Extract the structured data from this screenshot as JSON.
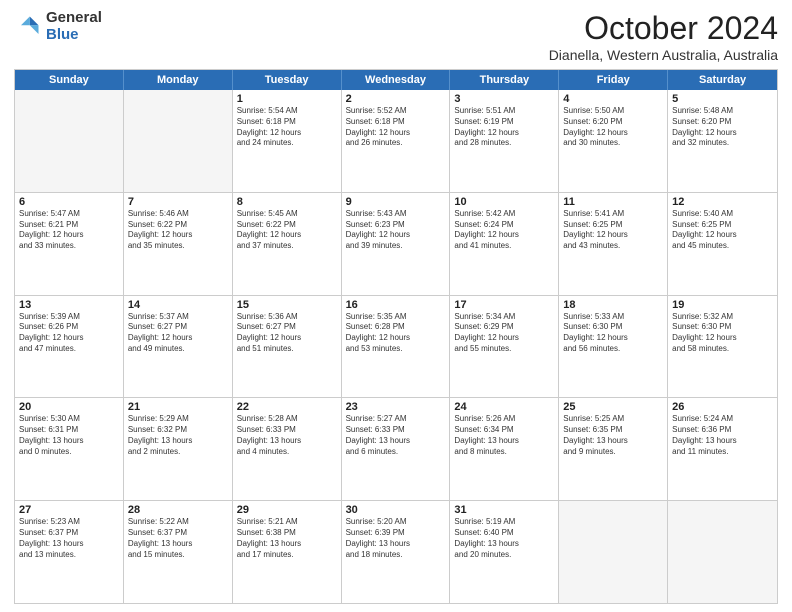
{
  "logo": {
    "general": "General",
    "blue": "Blue"
  },
  "header": {
    "month": "October 2024",
    "location": "Dianella, Western Australia, Australia"
  },
  "weekdays": [
    "Sunday",
    "Monday",
    "Tuesday",
    "Wednesday",
    "Thursday",
    "Friday",
    "Saturday"
  ],
  "rows": [
    [
      {
        "day": "",
        "info": "",
        "empty": true
      },
      {
        "day": "",
        "info": "",
        "empty": true
      },
      {
        "day": "1",
        "info": "Sunrise: 5:54 AM\nSunset: 6:18 PM\nDaylight: 12 hours\nand 24 minutes."
      },
      {
        "day": "2",
        "info": "Sunrise: 5:52 AM\nSunset: 6:18 PM\nDaylight: 12 hours\nand 26 minutes."
      },
      {
        "day": "3",
        "info": "Sunrise: 5:51 AM\nSunset: 6:19 PM\nDaylight: 12 hours\nand 28 minutes."
      },
      {
        "day": "4",
        "info": "Sunrise: 5:50 AM\nSunset: 6:20 PM\nDaylight: 12 hours\nand 30 minutes."
      },
      {
        "day": "5",
        "info": "Sunrise: 5:48 AM\nSunset: 6:20 PM\nDaylight: 12 hours\nand 32 minutes."
      }
    ],
    [
      {
        "day": "6",
        "info": "Sunrise: 5:47 AM\nSunset: 6:21 PM\nDaylight: 12 hours\nand 33 minutes."
      },
      {
        "day": "7",
        "info": "Sunrise: 5:46 AM\nSunset: 6:22 PM\nDaylight: 12 hours\nand 35 minutes."
      },
      {
        "day": "8",
        "info": "Sunrise: 5:45 AM\nSunset: 6:22 PM\nDaylight: 12 hours\nand 37 minutes."
      },
      {
        "day": "9",
        "info": "Sunrise: 5:43 AM\nSunset: 6:23 PM\nDaylight: 12 hours\nand 39 minutes."
      },
      {
        "day": "10",
        "info": "Sunrise: 5:42 AM\nSunset: 6:24 PM\nDaylight: 12 hours\nand 41 minutes."
      },
      {
        "day": "11",
        "info": "Sunrise: 5:41 AM\nSunset: 6:25 PM\nDaylight: 12 hours\nand 43 minutes."
      },
      {
        "day": "12",
        "info": "Sunrise: 5:40 AM\nSunset: 6:25 PM\nDaylight: 12 hours\nand 45 minutes."
      }
    ],
    [
      {
        "day": "13",
        "info": "Sunrise: 5:39 AM\nSunset: 6:26 PM\nDaylight: 12 hours\nand 47 minutes."
      },
      {
        "day": "14",
        "info": "Sunrise: 5:37 AM\nSunset: 6:27 PM\nDaylight: 12 hours\nand 49 minutes."
      },
      {
        "day": "15",
        "info": "Sunrise: 5:36 AM\nSunset: 6:27 PM\nDaylight: 12 hours\nand 51 minutes."
      },
      {
        "day": "16",
        "info": "Sunrise: 5:35 AM\nSunset: 6:28 PM\nDaylight: 12 hours\nand 53 minutes."
      },
      {
        "day": "17",
        "info": "Sunrise: 5:34 AM\nSunset: 6:29 PM\nDaylight: 12 hours\nand 55 minutes."
      },
      {
        "day": "18",
        "info": "Sunrise: 5:33 AM\nSunset: 6:30 PM\nDaylight: 12 hours\nand 56 minutes."
      },
      {
        "day": "19",
        "info": "Sunrise: 5:32 AM\nSunset: 6:30 PM\nDaylight: 12 hours\nand 58 minutes."
      }
    ],
    [
      {
        "day": "20",
        "info": "Sunrise: 5:30 AM\nSunset: 6:31 PM\nDaylight: 13 hours\nand 0 minutes."
      },
      {
        "day": "21",
        "info": "Sunrise: 5:29 AM\nSunset: 6:32 PM\nDaylight: 13 hours\nand 2 minutes."
      },
      {
        "day": "22",
        "info": "Sunrise: 5:28 AM\nSunset: 6:33 PM\nDaylight: 13 hours\nand 4 minutes."
      },
      {
        "day": "23",
        "info": "Sunrise: 5:27 AM\nSunset: 6:33 PM\nDaylight: 13 hours\nand 6 minutes."
      },
      {
        "day": "24",
        "info": "Sunrise: 5:26 AM\nSunset: 6:34 PM\nDaylight: 13 hours\nand 8 minutes."
      },
      {
        "day": "25",
        "info": "Sunrise: 5:25 AM\nSunset: 6:35 PM\nDaylight: 13 hours\nand 9 minutes."
      },
      {
        "day": "26",
        "info": "Sunrise: 5:24 AM\nSunset: 6:36 PM\nDaylight: 13 hours\nand 11 minutes."
      }
    ],
    [
      {
        "day": "27",
        "info": "Sunrise: 5:23 AM\nSunset: 6:37 PM\nDaylight: 13 hours\nand 13 minutes."
      },
      {
        "day": "28",
        "info": "Sunrise: 5:22 AM\nSunset: 6:37 PM\nDaylight: 13 hours\nand 15 minutes."
      },
      {
        "day": "29",
        "info": "Sunrise: 5:21 AM\nSunset: 6:38 PM\nDaylight: 13 hours\nand 17 minutes."
      },
      {
        "day": "30",
        "info": "Sunrise: 5:20 AM\nSunset: 6:39 PM\nDaylight: 13 hours\nand 18 minutes."
      },
      {
        "day": "31",
        "info": "Sunrise: 5:19 AM\nSunset: 6:40 PM\nDaylight: 13 hours\nand 20 minutes."
      },
      {
        "day": "",
        "info": "",
        "empty": true
      },
      {
        "day": "",
        "info": "",
        "empty": true
      }
    ]
  ]
}
